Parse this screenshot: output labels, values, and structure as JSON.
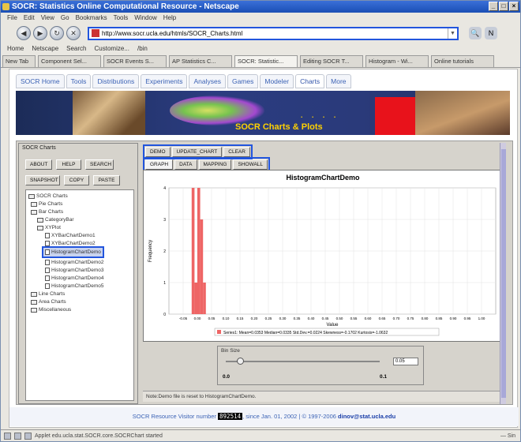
{
  "window": {
    "title": "SOCR: Statistics Online Computational Resource - Netscape"
  },
  "menu": [
    "File",
    "Edit",
    "View",
    "Go",
    "Bookmarks",
    "Tools",
    "Window",
    "Help"
  ],
  "address": {
    "url": "http://www.socr.ucla.edu/htmls/SOCR_Charts.html"
  },
  "bookmarks": [
    "Home",
    "Netscape",
    "Search",
    "Customize...",
    "/bin"
  ],
  "browser_tabs": [
    "New Tab",
    "Component Sel...",
    "SOCR Events S...",
    "AP Statistics C...",
    "SOCR: Statistic...",
    "Editing SOCR T...",
    "Histogram - Wi...",
    "Online tutorials"
  ],
  "socr_tabs": [
    "SOCR Home",
    "Tools",
    "Distributions",
    "Experiments",
    "Analyses",
    "Games",
    "Modeler",
    "Charts",
    "More"
  ],
  "banner": {
    "title": "SOCR Charts & Plots"
  },
  "left_panel": {
    "title": "SOCR Charts",
    "buttons_row1": [
      "ABOUT",
      "HELP",
      "SEARCH"
    ],
    "buttons_row2": [
      "SNAPSHOT",
      "COPY",
      "PASTE"
    ],
    "tree": [
      "SOCR Charts",
      "Pie Charts",
      "Bar Charts",
      "CategoryBar",
      "XYPlot",
      "XYBarChartDemo1",
      "XYBarChartDemo2",
      "HistogramChartDemo",
      "HistogramChartDemo2",
      "HistogramChartDemo3",
      "HistogramChartDemo4",
      "HistogramChartDemo5",
      "Line Charts",
      "Area Charts",
      "Miscellaneous"
    ]
  },
  "right_panel": {
    "top_buttons": [
      "DEMO",
      "UPDATE_CHART",
      "CLEAR"
    ],
    "sub_tabs": [
      "GRAPH",
      "DATA",
      "MAPPING",
      "SHOWALL"
    ],
    "bin_size_label": "Bin Size",
    "slider_value": "0.05",
    "slider_min": "0.0",
    "slider_max": "0.1",
    "status": "Note:Demo file is reset to HistogramChartDemo."
  },
  "chart_data": {
    "type": "bar",
    "title": "HistogramChartDemo",
    "xlabel": "Value",
    "ylabel": "Frequency",
    "xlim": [
      -0.1,
      1.05
    ],
    "ylim": [
      0,
      4
    ],
    "yticks": [
      "0",
      "1",
      "2",
      "3",
      "4"
    ],
    "xticks": [
      "-0.05",
      "0.00",
      "0.05",
      "0.10",
      "0.15",
      "0.20",
      "0.25",
      "0.30",
      "0.35",
      "0.40",
      "0.45",
      "0.50",
      "0.55",
      "0.60",
      "0.65",
      "0.70",
      "0.75",
      "0.80",
      "0.85",
      "0.90",
      "0.95",
      "1.00"
    ],
    "bins": [
      {
        "x": -0.015,
        "value": 4
      },
      {
        "x": -0.005,
        "value": 1
      },
      {
        "x": 0.005,
        "value": 4
      },
      {
        "x": 0.015,
        "value": 3
      },
      {
        "x": 0.025,
        "value": 1
      }
    ],
    "legend": "Series1: Mean=0.0353 Median=0.0335 Std.Dev.=0.0224 Skewness=-0.1702 Kurtosis=-1.0632",
    "bar_color": "#ee6565",
    "grid": true
  },
  "footer": {
    "prefix": "SOCR Resource Visitor number",
    "counter": "892514",
    "suffix": ", since Jan. 01, 2002 | © 1997-2006",
    "email": "dinov@stat.ucla.edu"
  },
  "statusbar": {
    "text": "Applet edu.ucla.stat.SOCR.core.SOCRChart started",
    "right": "—  Sin"
  }
}
